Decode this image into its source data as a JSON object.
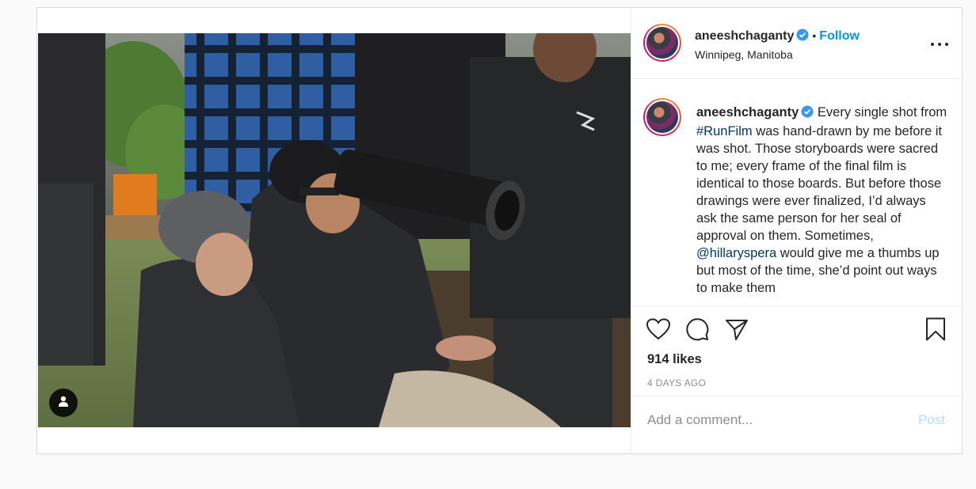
{
  "post": {
    "username": "aneeshchaganty",
    "separator": "•",
    "follow_label": "Follow",
    "location": "Winnipeg, Manitoba",
    "caption_parts": {
      "p1": "Every single shot from ",
      "hashtag": "#RunFilm",
      "p2": " was hand-drawn by me before it was shot. Those storyboards were sacred to me; every frame of the final film is identical to those boards. But before those drawings were ever finalized, I’d always ask the same person for her seal of approval on them. Sometimes, ",
      "mention": "@hillaryspera",
      "p3": " would give me a thumbs up but most of the time, she’d point out ways to make them"
    },
    "likes": "914 likes",
    "time_ago": "4 DAYS AGO",
    "comment_placeholder": "Add a comment...",
    "post_label": "Post"
  },
  "icons": {
    "verified": "verified-badge-icon",
    "more": "more-options-icon",
    "like": "heart-icon",
    "comment": "comment-bubble-icon",
    "share": "paper-plane-icon",
    "save": "bookmark-icon",
    "tags": "user-tag-icon"
  },
  "colors": {
    "accent": "#0095f6",
    "post_disabled": "#b2dffc",
    "link": "#00376b",
    "muted": "#8e8e8e"
  }
}
